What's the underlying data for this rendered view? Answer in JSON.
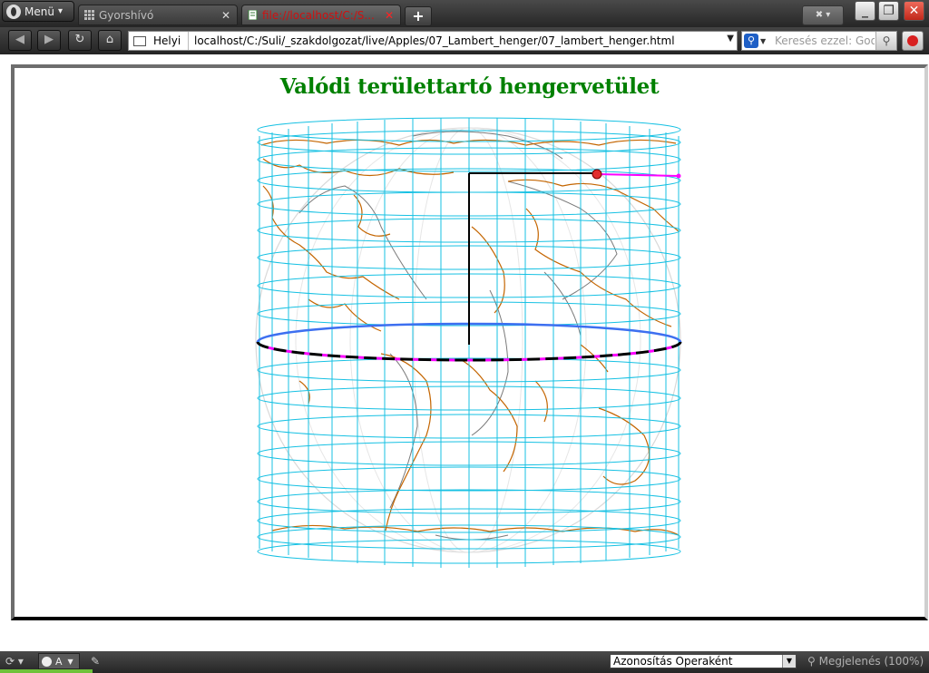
{
  "browser": {
    "menu_label": "Menü",
    "tabs": [
      {
        "label": "Gyorshívó",
        "active": false
      },
      {
        "label": "file://localhost/C:/S...",
        "active": true
      }
    ],
    "new_tab_symbol": "+",
    "address": {
      "site_label": "Helyi",
      "url": "localhost/C:/Suli/_szakdolgozat/live/Apples/07_Lambert_henger/07_lambert_henger.html"
    },
    "search": {
      "placeholder": "Keresés ezzel: Goo"
    }
  },
  "page": {
    "title": "Valódi területtartó hengervetület",
    "colors": {
      "title": "#008000",
      "grid": "#17c1e3",
      "coastline_cylinder": "#c46500",
      "coastline_globe": "#7b7b7b",
      "highlight_parallel": "#ff00ff",
      "marker": "#e22d2d"
    }
  },
  "statusbar": {
    "block_label": "A",
    "identify_as": "Azonosítás Operaként",
    "zoom_label": "Megjelenés (100%)",
    "load_progress": 0.1
  }
}
